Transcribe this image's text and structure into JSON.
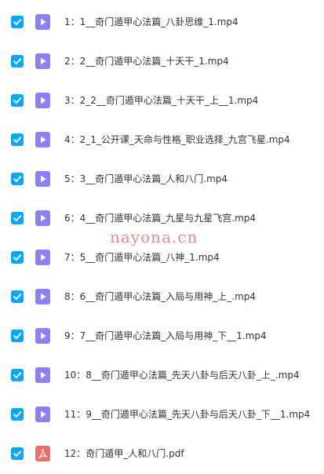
{
  "colors": {
    "checkbox": "#06a7ff",
    "video_icon": "#8b80f9",
    "pdf_icon": "#f46a6a",
    "text": "#333333",
    "watermark": "#f07c7c"
  },
  "files": [
    {
      "name": "1：1__奇门遁甲心法篇_八卦思维_1.mp4",
      "type": "video-file-icon",
      "checked": true
    },
    {
      "name": "2：2__奇门遁甲心法篇_十天干_1.mp4",
      "type": "video-file-icon",
      "checked": true
    },
    {
      "name": "3：2_2__奇门遁甲心法篇_十天干_上__1.mp4",
      "type": "video-file-icon",
      "checked": true
    },
    {
      "name": "4：2_1_公开课_天命与性格_职业选择_九宫飞星.mp4",
      "type": "video-file-icon",
      "checked": true
    },
    {
      "name": "5：3__奇门遁甲心法篇_人和八门.mp4",
      "type": "video-file-icon",
      "checked": true
    },
    {
      "name": "6：4__奇门遁甲心法篇_九星与九星飞宫.mp4",
      "type": "video-file-icon",
      "checked": true
    },
    {
      "name": "7：5__奇门遁甲心法篇_八神_1.mp4",
      "type": "video-file-icon",
      "checked": true
    },
    {
      "name": "8：6__奇门遁甲心法篇_入局与用神_上_.mp4",
      "type": "video-file-icon",
      "checked": true
    },
    {
      "name": "9：7__奇门遁甲心法篇_入局与用神_下__1.mp4",
      "type": "video-file-icon",
      "checked": true
    },
    {
      "name": "10：8__奇门遁甲心法篇_先天八卦与后天八卦_上_.mp4",
      "type": "video-file-icon",
      "checked": true
    },
    {
      "name": "11：9__奇门遁甲心法篇_先天八卦与后天八卦_下__1.mp4",
      "type": "video-file-icon",
      "checked": true
    },
    {
      "name": "12：奇门遁甲_人和八门.pdf",
      "type": "pdf-file-icon",
      "checked": true
    }
  ],
  "watermark": {
    "text": "nayona.cn"
  }
}
